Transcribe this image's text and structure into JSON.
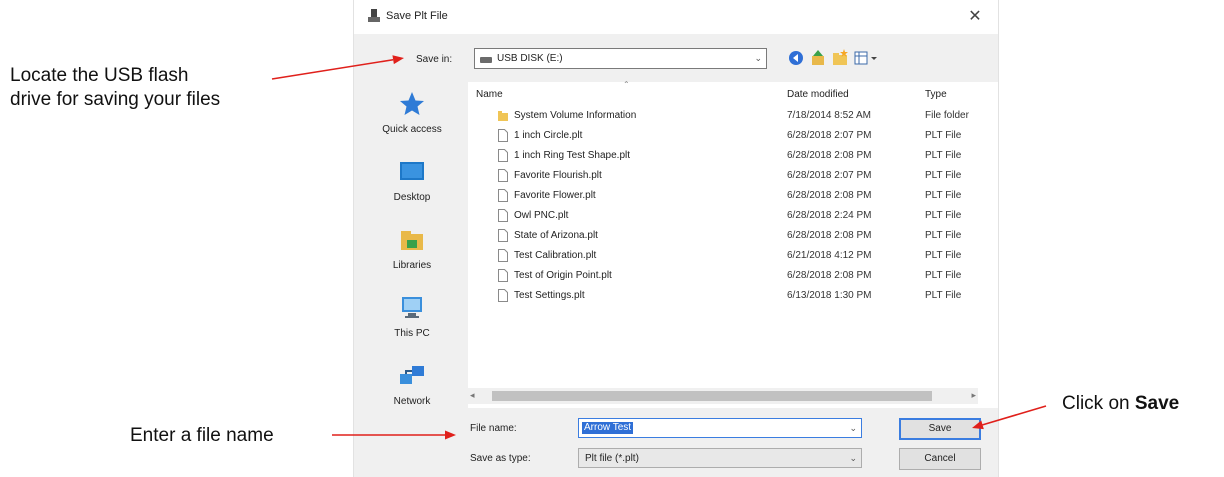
{
  "annotations": {
    "locate_line1": "Locate the USB flash",
    "locate_line2": "drive for saving your files",
    "enter_name": "Enter a file name",
    "click_prefix": "Click on ",
    "click_bold": "Save"
  },
  "dialog": {
    "title": "Save Plt File",
    "close_glyph": "✕",
    "save_in_label": "Save in:",
    "save_in_value": "USB DISK (E:)",
    "toolbar_icons": [
      "back-icon",
      "up-folder-icon",
      "new-folder-icon",
      "view-menu-icon"
    ]
  },
  "places": [
    {
      "label": "Quick access",
      "icon": "star-icon"
    },
    {
      "label": "Desktop",
      "icon": "desktop-icon"
    },
    {
      "label": "Libraries",
      "icon": "libraries-icon"
    },
    {
      "label": "This PC",
      "icon": "computer-icon"
    },
    {
      "label": "Network",
      "icon": "network-icon"
    }
  ],
  "columns": {
    "name": "Name",
    "date": "Date modified",
    "type": "Type"
  },
  "files": [
    {
      "name": "System Volume Information",
      "date": "7/18/2014 8:52 AM",
      "type": "File folder",
      "kind": "folder"
    },
    {
      "name": "1 inch Circle.plt",
      "date": "6/28/2018 2:07 PM",
      "type": "PLT File",
      "kind": "file"
    },
    {
      "name": "1 inch Ring Test Shape.plt",
      "date": "6/28/2018 2:08 PM",
      "type": "PLT File",
      "kind": "file"
    },
    {
      "name": "Favorite Flourish.plt",
      "date": "6/28/2018 2:07 PM",
      "type": "PLT File",
      "kind": "file"
    },
    {
      "name": "Favorite Flower.plt",
      "date": "6/28/2018 2:08 PM",
      "type": "PLT File",
      "kind": "file"
    },
    {
      "name": "Owl PNC.plt",
      "date": "6/28/2018 2:24 PM",
      "type": "PLT File",
      "kind": "file"
    },
    {
      "name": "State of Arizona.plt",
      "date": "6/28/2018 2:08 PM",
      "type": "PLT File",
      "kind": "file"
    },
    {
      "name": "Test Calibration.plt",
      "date": "6/21/2018 4:12 PM",
      "type": "PLT File",
      "kind": "file"
    },
    {
      "name": "Test of Origin Point.plt",
      "date": "6/28/2018 2:08 PM",
      "type": "PLT File",
      "kind": "file"
    },
    {
      "name": "Test Settings.plt",
      "date": "6/13/2018 1:30 PM",
      "type": "PLT File",
      "kind": "file"
    }
  ],
  "footer": {
    "file_name_label": "File name:",
    "file_name_value": "Arrow Test",
    "save_as_label": "Save as type:",
    "save_as_value": "Plt file (*.plt)",
    "save_button": "Save",
    "cancel_button": "Cancel"
  },
  "colors": {
    "arrow": "#e0201b",
    "selection": "#2f6fd6",
    "focus": "#3b7de0"
  }
}
